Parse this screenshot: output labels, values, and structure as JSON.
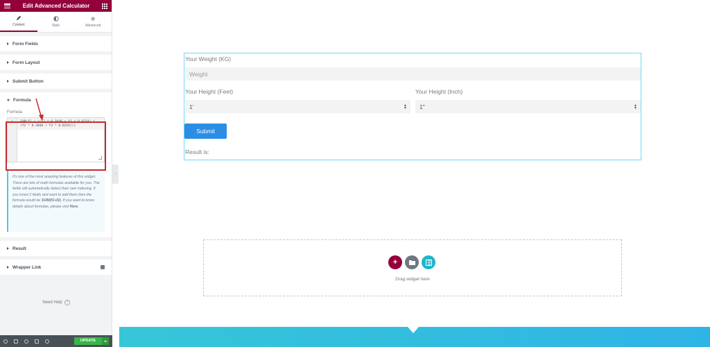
{
  "panel": {
    "title": "Edit Advanced Calculator",
    "tabs": [
      {
        "label": "Content"
      },
      {
        "label": "Style"
      },
      {
        "label": "Advanced"
      }
    ],
    "sections_top": [
      {
        "label": "Form Fields"
      },
      {
        "label": "Form Layout"
      },
      {
        "label": "Submit Button"
      }
    ],
    "formula": {
      "section_label": "Formula",
      "field_label": "Formula",
      "line_number": "1",
      "code": "SUM(f1 / ((f2 * 0.3048 + f3 * 0.0254) * (f2 * 0.3048 + f3 * 0.0254)))",
      "info_text_1": "It's one of the most amazing features of this widget. There are lots of math formulas available for you. The fields will automatically detect their own indexing. If you insert 2 fields and want to add them then the formula would be ",
      "info_bold_1": "SUM(f1+f2)",
      "info_text_2": ". If you want to know details about formulas, please visit ",
      "info_bold_2": "Here",
      "info_text_3": "."
    },
    "sections_bottom": [
      {
        "label": "Result"
      },
      {
        "label": "Wrapper Link"
      }
    ],
    "need_help": "Need Help",
    "update_label": "UPDATE"
  },
  "calculator": {
    "weight_label": "Your Weight (KG)",
    "weight_placeholder": "Weight",
    "height_feet_label": "Your Height (Feet)",
    "height_feet_value": "1'",
    "height_inch_label": "Your Height (Inch)",
    "height_inch_value": "1\"",
    "submit_label": "Submit",
    "result_label": "Result is:"
  },
  "dropzone": {
    "text": "Drag widget here"
  },
  "colors": {
    "brand": "#93003c",
    "accent_blue": "#2b8ee5",
    "update_green": "#39b54a",
    "highlight_red": "#c42a2a"
  }
}
